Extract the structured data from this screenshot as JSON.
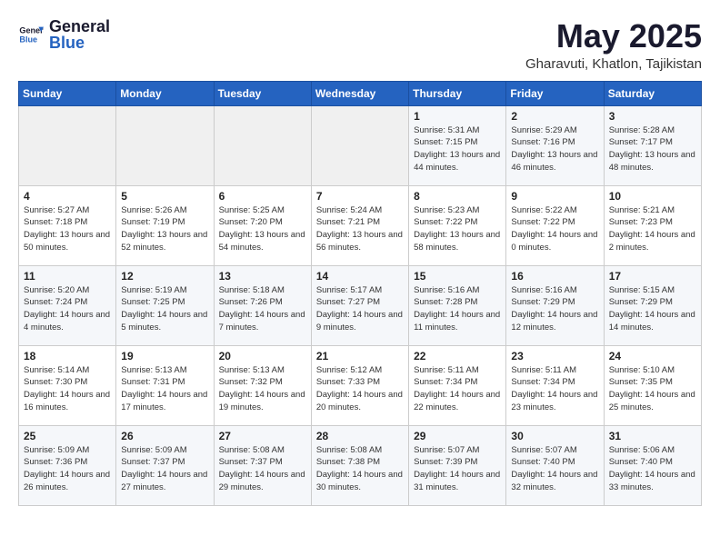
{
  "header": {
    "logo_general": "General",
    "logo_blue": "Blue",
    "title": "May 2025",
    "location": "Gharavuti, Khatlon, Tajikistan"
  },
  "weekdays": [
    "Sunday",
    "Monday",
    "Tuesday",
    "Wednesday",
    "Thursday",
    "Friday",
    "Saturday"
  ],
  "weeks": [
    [
      {
        "day": "",
        "empty": true
      },
      {
        "day": "",
        "empty": true
      },
      {
        "day": "",
        "empty": true
      },
      {
        "day": "",
        "empty": true
      },
      {
        "day": "1",
        "sunrise": "5:31 AM",
        "sunset": "7:15 PM",
        "daylight": "13 hours and 44 minutes."
      },
      {
        "day": "2",
        "sunrise": "5:29 AM",
        "sunset": "7:16 PM",
        "daylight": "13 hours and 46 minutes."
      },
      {
        "day": "3",
        "sunrise": "5:28 AM",
        "sunset": "7:17 PM",
        "daylight": "13 hours and 48 minutes."
      }
    ],
    [
      {
        "day": "4",
        "sunrise": "5:27 AM",
        "sunset": "7:18 PM",
        "daylight": "13 hours and 50 minutes."
      },
      {
        "day": "5",
        "sunrise": "5:26 AM",
        "sunset": "7:19 PM",
        "daylight": "13 hours and 52 minutes."
      },
      {
        "day": "6",
        "sunrise": "5:25 AM",
        "sunset": "7:20 PM",
        "daylight": "13 hours and 54 minutes."
      },
      {
        "day": "7",
        "sunrise": "5:24 AM",
        "sunset": "7:21 PM",
        "daylight": "13 hours and 56 minutes."
      },
      {
        "day": "8",
        "sunrise": "5:23 AM",
        "sunset": "7:22 PM",
        "daylight": "13 hours and 58 minutes."
      },
      {
        "day": "9",
        "sunrise": "5:22 AM",
        "sunset": "7:22 PM",
        "daylight": "14 hours and 0 minutes."
      },
      {
        "day": "10",
        "sunrise": "5:21 AM",
        "sunset": "7:23 PM",
        "daylight": "14 hours and 2 minutes."
      }
    ],
    [
      {
        "day": "11",
        "sunrise": "5:20 AM",
        "sunset": "7:24 PM",
        "daylight": "14 hours and 4 minutes."
      },
      {
        "day": "12",
        "sunrise": "5:19 AM",
        "sunset": "7:25 PM",
        "daylight": "14 hours and 5 minutes."
      },
      {
        "day": "13",
        "sunrise": "5:18 AM",
        "sunset": "7:26 PM",
        "daylight": "14 hours and 7 minutes."
      },
      {
        "day": "14",
        "sunrise": "5:17 AM",
        "sunset": "7:27 PM",
        "daylight": "14 hours and 9 minutes."
      },
      {
        "day": "15",
        "sunrise": "5:16 AM",
        "sunset": "7:28 PM",
        "daylight": "14 hours and 11 minutes."
      },
      {
        "day": "16",
        "sunrise": "5:16 AM",
        "sunset": "7:29 PM",
        "daylight": "14 hours and 12 minutes."
      },
      {
        "day": "17",
        "sunrise": "5:15 AM",
        "sunset": "7:29 PM",
        "daylight": "14 hours and 14 minutes."
      }
    ],
    [
      {
        "day": "18",
        "sunrise": "5:14 AM",
        "sunset": "7:30 PM",
        "daylight": "14 hours and 16 minutes."
      },
      {
        "day": "19",
        "sunrise": "5:13 AM",
        "sunset": "7:31 PM",
        "daylight": "14 hours and 17 minutes."
      },
      {
        "day": "20",
        "sunrise": "5:13 AM",
        "sunset": "7:32 PM",
        "daylight": "14 hours and 19 minutes."
      },
      {
        "day": "21",
        "sunrise": "5:12 AM",
        "sunset": "7:33 PM",
        "daylight": "14 hours and 20 minutes."
      },
      {
        "day": "22",
        "sunrise": "5:11 AM",
        "sunset": "7:34 PM",
        "daylight": "14 hours and 22 minutes."
      },
      {
        "day": "23",
        "sunrise": "5:11 AM",
        "sunset": "7:34 PM",
        "daylight": "14 hours and 23 minutes."
      },
      {
        "day": "24",
        "sunrise": "5:10 AM",
        "sunset": "7:35 PM",
        "daylight": "14 hours and 25 minutes."
      }
    ],
    [
      {
        "day": "25",
        "sunrise": "5:09 AM",
        "sunset": "7:36 PM",
        "daylight": "14 hours and 26 minutes."
      },
      {
        "day": "26",
        "sunrise": "5:09 AM",
        "sunset": "7:37 PM",
        "daylight": "14 hours and 27 minutes."
      },
      {
        "day": "27",
        "sunrise": "5:08 AM",
        "sunset": "7:37 PM",
        "daylight": "14 hours and 29 minutes."
      },
      {
        "day": "28",
        "sunrise": "5:08 AM",
        "sunset": "7:38 PM",
        "daylight": "14 hours and 30 minutes."
      },
      {
        "day": "29",
        "sunrise": "5:07 AM",
        "sunset": "7:39 PM",
        "daylight": "14 hours and 31 minutes."
      },
      {
        "day": "30",
        "sunrise": "5:07 AM",
        "sunset": "7:40 PM",
        "daylight": "14 hours and 32 minutes."
      },
      {
        "day": "31",
        "sunrise": "5:06 AM",
        "sunset": "7:40 PM",
        "daylight": "14 hours and 33 minutes."
      }
    ]
  ],
  "labels": {
    "sunrise_label": "Sunrise:",
    "sunset_label": "Sunset:",
    "daylight_label": "Daylight:"
  }
}
